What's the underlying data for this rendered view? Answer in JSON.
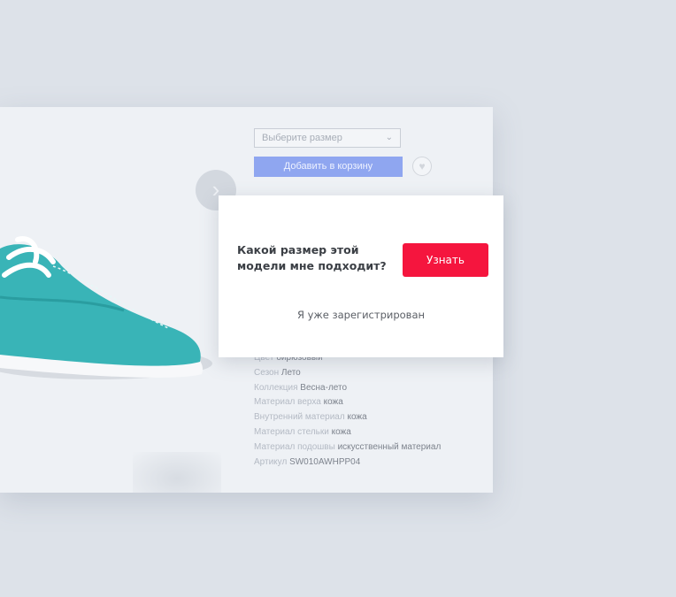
{
  "product": {
    "size_select": {
      "placeholder": "Выберите размер"
    },
    "add_to_cart_label": "Добавить в корзину",
    "specs": [
      {
        "label": "Цвет",
        "value": "бирюзовый"
      },
      {
        "label": "Сезон",
        "value": "Лето"
      },
      {
        "label": "Коллекция",
        "value": "Весна-лето"
      },
      {
        "label": "Материал верха",
        "value": "кожа"
      },
      {
        "label": "Внутренний материал",
        "value": "кожа"
      },
      {
        "label": "Материал стельки",
        "value": "кожа"
      },
      {
        "label": "Материал подошвы",
        "value": "искусственный материал"
      },
      {
        "label": "Артикул",
        "value": "SW010AWHPP04"
      }
    ]
  },
  "popup": {
    "question": "Какой размер этой модели мне подходит?",
    "button_label": "Узнать",
    "link_label": "Я уже зарегистрирован"
  },
  "colors": {
    "accent_button": "#f5153e",
    "cart_button": "#8fa6f0",
    "shoe": "#3ab5b8"
  }
}
